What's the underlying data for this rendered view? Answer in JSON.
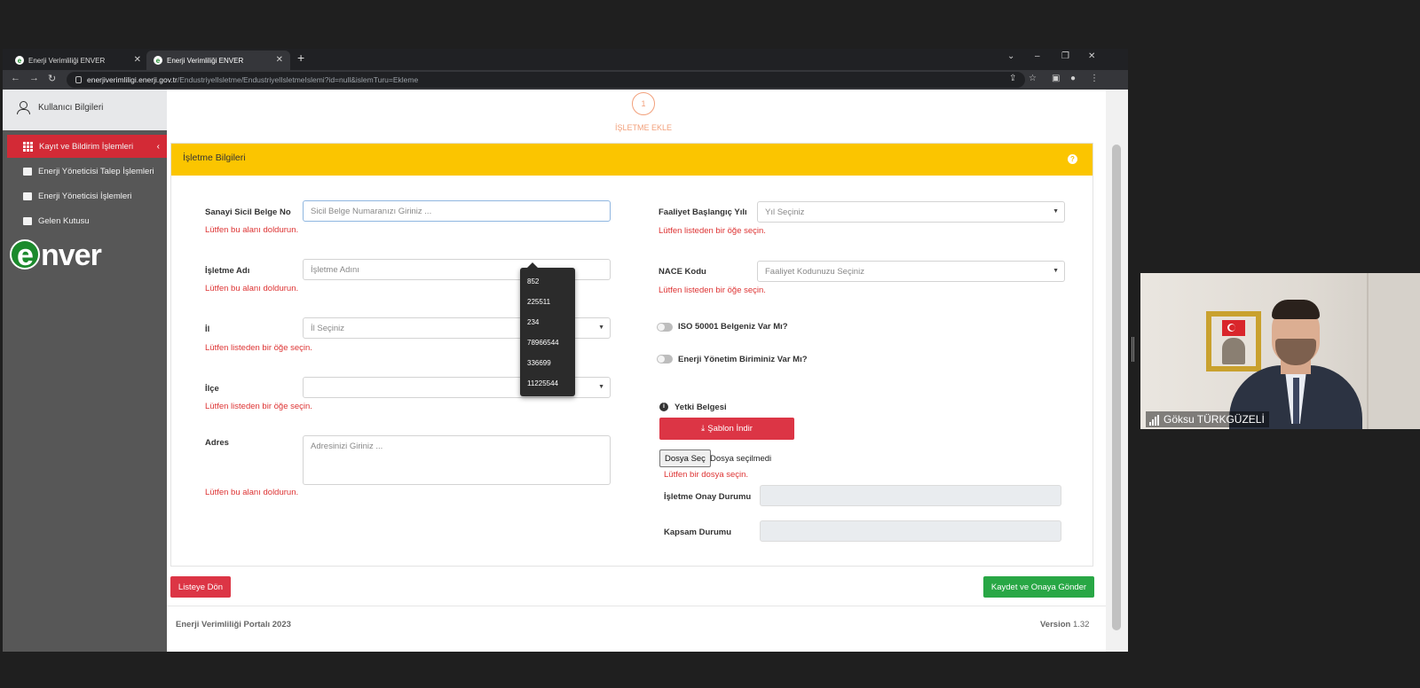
{
  "browser": {
    "tabs": [
      {
        "label": "Enerji Verimliliği ENVER"
      },
      {
        "label": "Enerji Verimliliği ENVER"
      }
    ],
    "url_host": "enerjiverimliligi.enerji.gov.tr",
    "url_path": "/EndustriyelIsletme/EndustriyelIsletmeIslemi?id=null&islemTuru=Ekleme"
  },
  "sidebar": {
    "user_label": "Kullanıcı Bilgileri",
    "items": [
      {
        "label": "Kayıt ve Bildirim İşlemleri"
      },
      {
        "label": "Enerji Yöneticisi Talep İşlemleri"
      },
      {
        "label": "Enerji Yöneticisi İşlemleri"
      },
      {
        "label": "Gelen Kutusu"
      }
    ],
    "logo_e": "e",
    "logo_text": "nver"
  },
  "stepper": {
    "number": "1",
    "label": "İŞLETME EKLE"
  },
  "card": {
    "title": "İşletme Bilgileri"
  },
  "form_left": {
    "sicil": {
      "label": "Sanayi Sicil Belge No",
      "placeholder": "Sicil Belge Numaranızı Giriniz ...",
      "error": "Lütfen bu alanı doldurun."
    },
    "isletme_adi": {
      "label": "İşletme Adı",
      "placeholder": "İşletme Adını",
      "error": "Lütfen bu alanı doldurun."
    },
    "il": {
      "label": "İl",
      "placeholder": "İl Seçiniz",
      "error": "Lütfen listeden bir öğe seçin."
    },
    "ilce": {
      "label": "İlçe",
      "placeholder": "",
      "error": "Lütfen listeden bir öğe seçin."
    },
    "adres": {
      "label": "Adres",
      "placeholder": "Adresinizi Giriniz ...",
      "error": "Lütfen bu alanı doldurun."
    }
  },
  "form_right": {
    "faaliyet": {
      "label": "Faaliyet Başlangıç Yılı",
      "placeholder": "Yıl Seçiniz",
      "error": "Lütfen listeden bir öğe seçin."
    },
    "nace": {
      "label": "NACE Kodu",
      "placeholder": "Faaliyet Kodunuzu Seçiniz",
      "error": "Lütfen listeden bir öğe seçin."
    },
    "iso_toggle": "ISO 50001 Belgeniz Var Mı?",
    "birim_toggle": "Enerji Yönetim Biriminiz Var Mı?",
    "yetki_title": "Yetki Belgesi",
    "sablon_button": "Şablon İndir",
    "dosya_button": "Dosya Seç",
    "dosya_status": "Dosya seçilmedi",
    "dosya_error": "Lütfen bir dosya seçin.",
    "onay_label": "İşletme Onay Durumu",
    "kapsam_label": "Kapsam Durumu"
  },
  "autocomplete": [
    "852",
    "225511",
    "234",
    "78966544",
    "336699",
    "11225544"
  ],
  "actions": {
    "back": "Listeye Dön",
    "submit": "Kaydet ve Onaya Gönder"
  },
  "footer": {
    "left": "Enerji Verimliliği Portalı 2023",
    "version_label": "Version",
    "version_value": "1.32"
  },
  "webcam": {
    "name": "Göksu TÜRKGÜZELİ"
  }
}
